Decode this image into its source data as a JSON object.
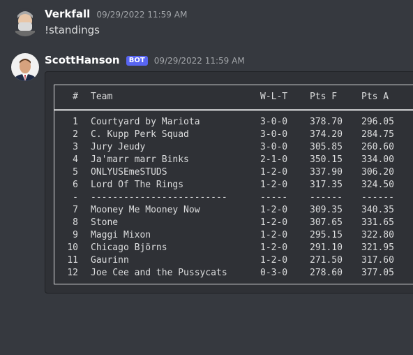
{
  "messages": [
    {
      "username": "Verkfall",
      "timestamp": "09/29/2022 11:59 AM",
      "text": "!standings"
    },
    {
      "username": "ScottHanson",
      "bot_tag": "BOT",
      "timestamp": "09/29/2022 11:59 AM"
    }
  ],
  "standings": {
    "headers": {
      "rank": "#",
      "team": "Team",
      "wlt": "W-L-T",
      "pts_for": "Pts F",
      "pts_against": "Pts A"
    },
    "rows": [
      {
        "rank": "1",
        "team": "Courtyard by Mariota",
        "wlt": "3-0-0",
        "pts_for": "378.70",
        "pts_against": "296.05"
      },
      {
        "rank": "2",
        "team": "C. Kupp Perk Squad",
        "wlt": "3-0-0",
        "pts_for": "374.20",
        "pts_against": "284.75"
      },
      {
        "rank": "3",
        "team": "Jury Jeudy",
        "wlt": "3-0-0",
        "pts_for": "305.85",
        "pts_against": "260.60"
      },
      {
        "rank": "4",
        "team": "Ja'marr marr Binks",
        "wlt": "2-1-0",
        "pts_for": "350.15",
        "pts_against": "334.00"
      },
      {
        "rank": "5",
        "team": "ONLYUSEmeSTUDS",
        "wlt": "1-2-0",
        "pts_for": "337.90",
        "pts_against": "306.20"
      },
      {
        "rank": "6",
        "team": "Lord Of The Rings",
        "wlt": "1-2-0",
        "pts_for": "317.35",
        "pts_against": "324.50"
      }
    ],
    "separator": {
      "rank": "-",
      "team": "-------------------------",
      "wlt": "-----",
      "pts_for": "------",
      "pts_against": "------"
    },
    "rows_lower": [
      {
        "rank": "7",
        "team": "Mooney Me Mooney Now",
        "wlt": "1-2-0",
        "pts_for": "309.35",
        "pts_against": "340.35"
      },
      {
        "rank": "8",
        "team": "Stone",
        "wlt": "1-2-0",
        "pts_for": "307.65",
        "pts_against": "331.65"
      },
      {
        "rank": "9",
        "team": "Maggi Mixon",
        "wlt": "1-2-0",
        "pts_for": "295.15",
        "pts_against": "322.80"
      },
      {
        "rank": "10",
        "team": "Chicago Björns",
        "wlt": "1-2-0",
        "pts_for": "291.10",
        "pts_against": "321.95"
      },
      {
        "rank": "11",
        "team": "Gaurinn",
        "wlt": "1-2-0",
        "pts_for": "271.50",
        "pts_against": "317.60"
      },
      {
        "rank": "12",
        "team": "Joe Cee and the Pussycats",
        "wlt": "0-3-0",
        "pts_for": "278.60",
        "pts_against": "377.05"
      }
    ]
  },
  "colors": {
    "background": "#36393f",
    "codeblock": "#2f3136",
    "bot_tag": "#5865f2"
  }
}
